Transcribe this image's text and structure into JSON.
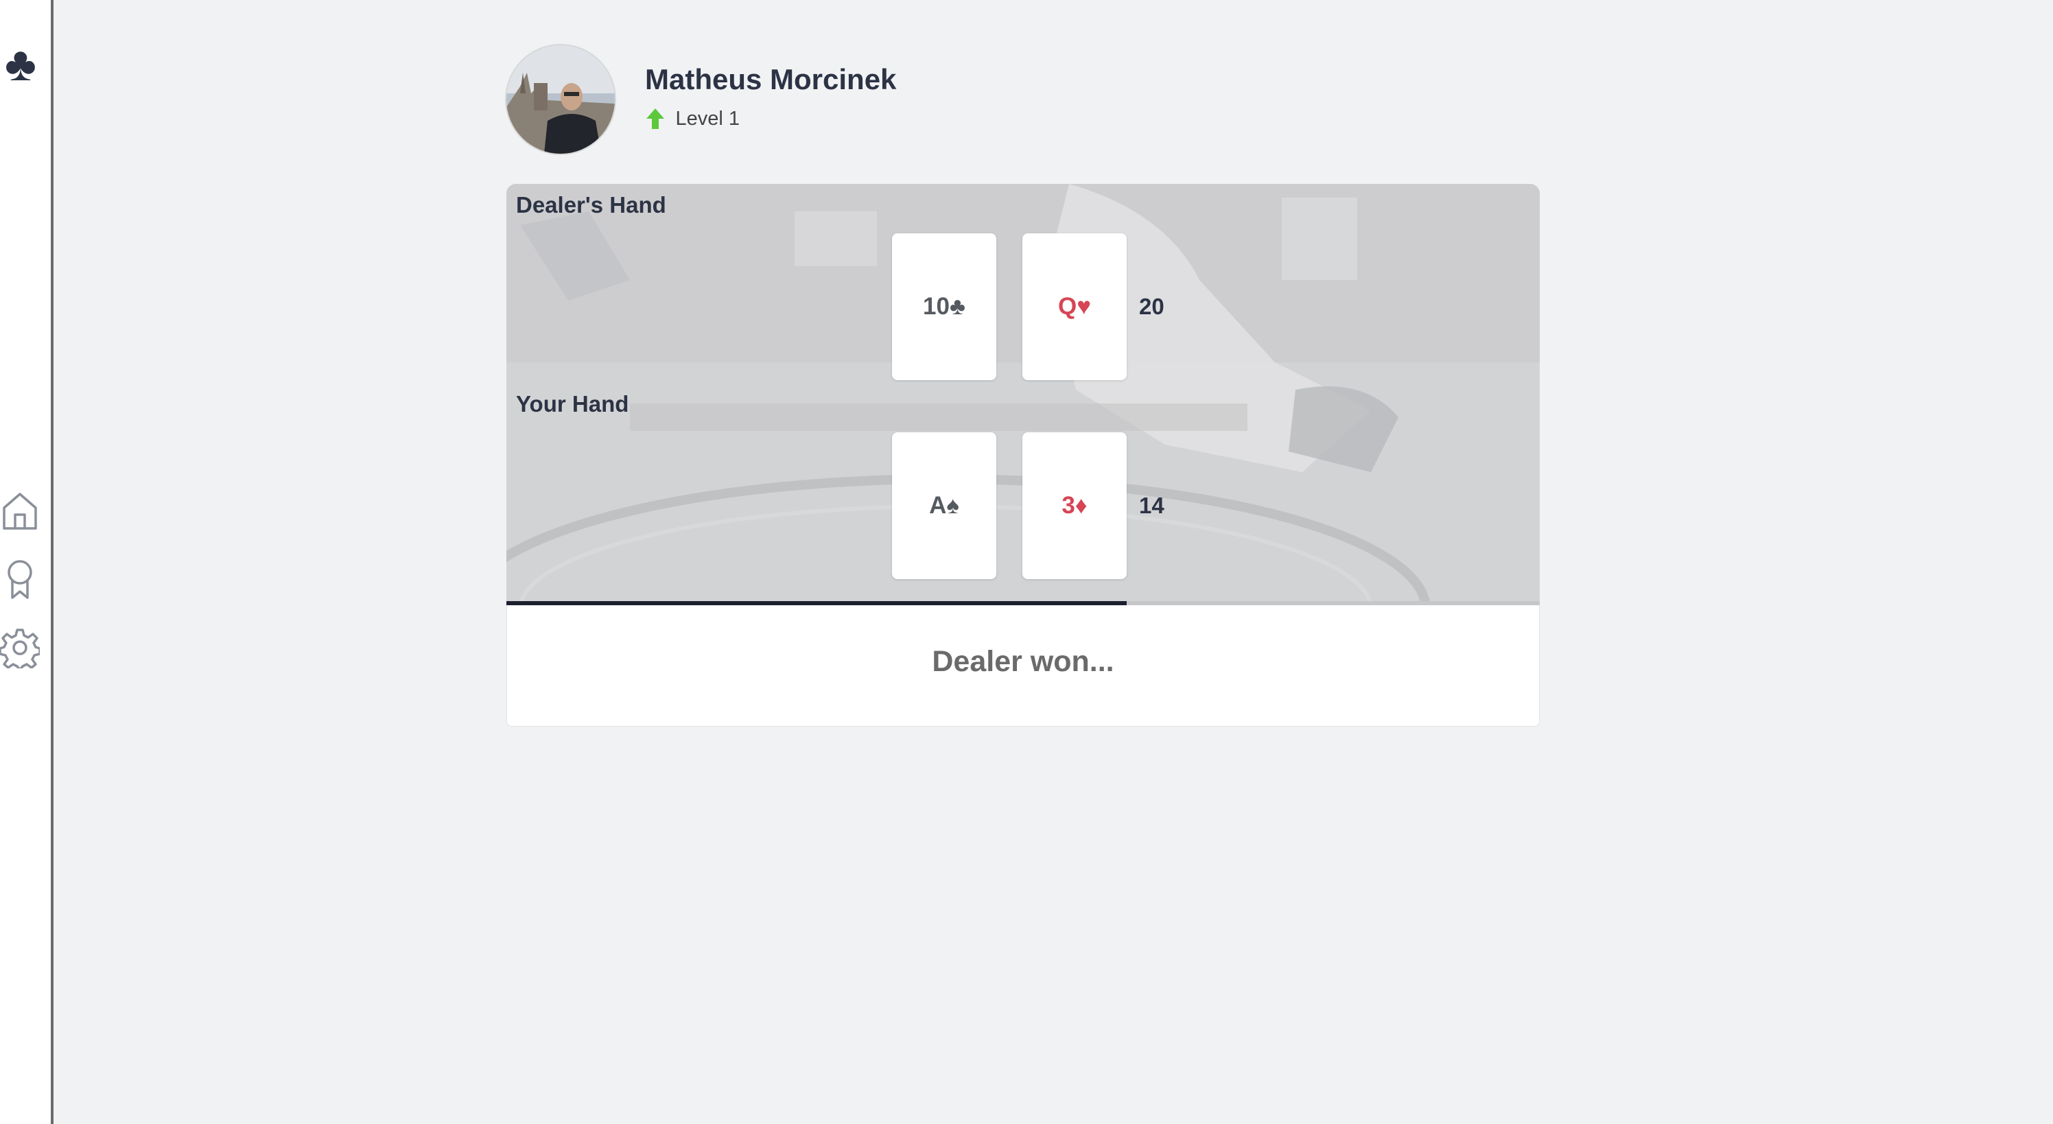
{
  "sidebar": {
    "logo": "♣",
    "items": [
      {
        "icon": "home-icon"
      },
      {
        "icon": "award-icon"
      },
      {
        "icon": "gear-icon"
      }
    ]
  },
  "profile": {
    "name": "Matheus Morcinek",
    "level_label": "Level 1",
    "level_icon": "arrow-up-icon",
    "level_icon_color": "#5cc83c"
  },
  "game": {
    "dealer": {
      "title": "Dealer's Hand",
      "cards": [
        {
          "rank": "10",
          "suit": "♣",
          "color": "black"
        },
        {
          "rank": "Q",
          "suit": "♥",
          "color": "red"
        }
      ],
      "score": "20"
    },
    "player": {
      "title": "Your Hand",
      "cards": [
        {
          "rank": "A",
          "suit": "♠",
          "color": "black"
        },
        {
          "rank": "3",
          "suit": "♦",
          "color": "red"
        }
      ],
      "score": "14"
    },
    "progress": 0.6,
    "result": "Dealer won..."
  },
  "colors": {
    "text_dark": "#2c3345",
    "card_red": "#d64555",
    "card_black": "#555a60"
  }
}
